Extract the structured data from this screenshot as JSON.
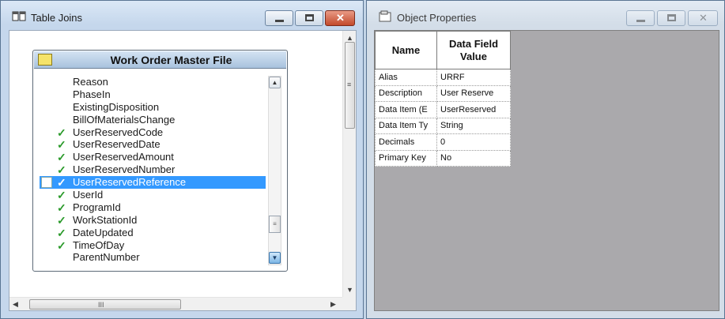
{
  "left_window": {
    "title": "Table Joins",
    "table": {
      "title": "Work Order Master File",
      "fields": [
        {
          "name": "Reason",
          "checked": false,
          "selected": false
        },
        {
          "name": "PhaseIn",
          "checked": false,
          "selected": false
        },
        {
          "name": "ExistingDisposition",
          "checked": false,
          "selected": false
        },
        {
          "name": "BillOfMaterialsChange",
          "checked": false,
          "selected": false
        },
        {
          "name": "UserReservedCode",
          "checked": true,
          "selected": false
        },
        {
          "name": "UserReservedDate",
          "checked": true,
          "selected": false
        },
        {
          "name": "UserReservedAmount",
          "checked": true,
          "selected": false
        },
        {
          "name": "UserReservedNumber",
          "checked": true,
          "selected": false
        },
        {
          "name": "UserReservedReference",
          "checked": true,
          "selected": true
        },
        {
          "name": "UserId",
          "checked": true,
          "selected": false
        },
        {
          "name": "ProgramId",
          "checked": true,
          "selected": false
        },
        {
          "name": "WorkStationId",
          "checked": true,
          "selected": false
        },
        {
          "name": "DateUpdated",
          "checked": true,
          "selected": false
        },
        {
          "name": "TimeOfDay",
          "checked": true,
          "selected": false
        },
        {
          "name": "ParentNumber",
          "checked": false,
          "selected": false
        }
      ]
    },
    "hscroll_grip": "III",
    "vscroll_grip": "≡"
  },
  "right_window": {
    "title": "Object Properties",
    "headers": {
      "name": "Name",
      "value": "Data Field Value"
    },
    "properties": [
      {
        "name": "Alias",
        "value": "URRF"
      },
      {
        "name": "Description",
        "value": "User Reserve"
      },
      {
        "name": "Data Item (E",
        "value": "UserReserved"
      },
      {
        "name": "Data Item Ty",
        "value": "String"
      },
      {
        "name": "Decimals",
        "value": "0"
      },
      {
        "name": "Primary Key",
        "value": "No"
      }
    ]
  },
  "icons": {
    "check": "✓",
    "minimize": "▭",
    "maximize": "□",
    "close": "✕",
    "up": "▲",
    "down": "▼",
    "left": "◀",
    "right": "▶"
  },
  "colors": {
    "selection": "#3399ff",
    "check": "#2a9a2a",
    "close": "#c24a2c"
  }
}
